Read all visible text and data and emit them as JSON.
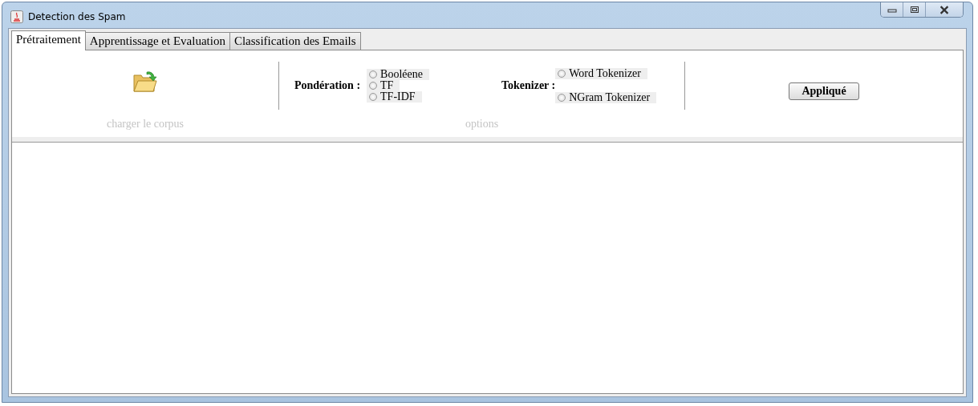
{
  "window": {
    "title": "Detection des Spam"
  },
  "tabs": [
    {
      "label": "Prétraitement",
      "selected": true
    },
    {
      "label": "Apprentissage et Evaluation",
      "selected": false
    },
    {
      "label": "Classification des Emails",
      "selected": false
    }
  ],
  "corpus": {
    "caption": "charger le corpus"
  },
  "options": {
    "caption": "options",
    "weighting": {
      "label": "Pondération :",
      "choices": [
        {
          "label": "Booléene",
          "selected": false
        },
        {
          "label": "TF",
          "selected": false
        },
        {
          "label": "TF-IDF",
          "selected": false
        }
      ]
    },
    "tokenizer": {
      "label": "Tokenizer :",
      "choices": [
        {
          "label": "Word Tokenizer",
          "selected": false
        },
        {
          "label": "NGram Tokenizer",
          "selected": false
        }
      ]
    }
  },
  "apply_button": "Appliqué"
}
